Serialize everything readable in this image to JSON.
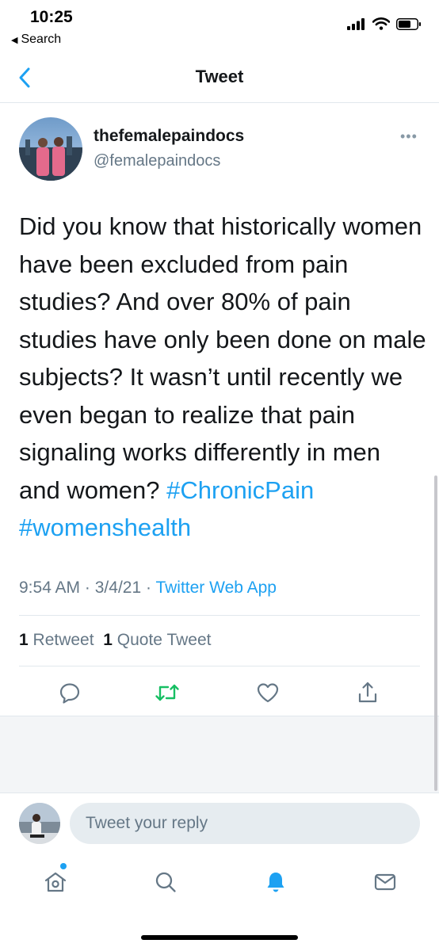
{
  "status_bar": {
    "time": "10:25",
    "back_label": "Search"
  },
  "nav": {
    "title": "Tweet"
  },
  "tweet": {
    "display_name": "thefemalepaindocs",
    "handle": "@femalepaindocs",
    "more_icon": "more-icon",
    "text": "Did you know that historically women have been excluded from pain studies? And over 80% of pain studies have only been done on male subjects? It wasn’t until recently we even began to realize that pain signaling works differently in men and women? ",
    "hashtag1": "#ChronicPain",
    "hashtag2": "#womenshealth",
    "time": "9:54 AM",
    "date": "3/4/21",
    "separator": "·",
    "source": "Twitter Web App",
    "retweets_count": "1",
    "retweets_label": "Retweet",
    "quotes_count": "1",
    "quotes_label": "Quote Tweet"
  },
  "actions": {
    "reply_icon": "reply-icon",
    "retweet_icon": "retweet-icon",
    "like_icon": "heart-icon",
    "share_icon": "share-icon"
  },
  "reply_bar": {
    "placeholder": "Tweet your reply"
  },
  "tab_bar": {
    "items": [
      "home-icon",
      "search-icon",
      "notifications-icon",
      "messages-icon"
    ],
    "notification_dot": true
  },
  "colors": {
    "accent": "#1da1f2",
    "retweet": "#17bf63",
    "text": "#14171a",
    "secondary": "#657786",
    "divider": "#e1e8ed"
  }
}
